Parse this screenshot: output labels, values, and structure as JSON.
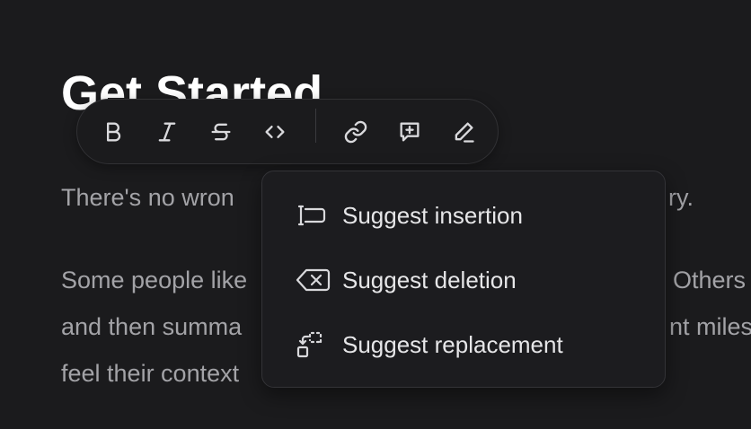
{
  "document": {
    "title": "Get Started",
    "paragraphs": [
      {
        "lines": [
          {
            "before": "There's no wron",
            "after": "ry."
          }
        ]
      },
      {
        "lines": [
          {
            "before": "Some people like",
            "after": "Others"
          },
          {
            "before": "and then summa",
            "after": "nt miles"
          },
          {
            "before": "feel their context",
            "after": ""
          }
        ]
      }
    ]
  },
  "toolbar": {
    "buttons": [
      {
        "name": "bold-button",
        "icon": "bold-icon"
      },
      {
        "name": "italic-button",
        "icon": "italic-icon"
      },
      {
        "name": "strikethrough-button",
        "icon": "strikethrough-icon"
      },
      {
        "name": "code-button",
        "icon": "code-icon"
      },
      {
        "name": "link-button",
        "icon": "link-icon"
      },
      {
        "name": "add-comment-button",
        "icon": "comment-plus-icon"
      },
      {
        "name": "suggest-button",
        "icon": "pencil-icon"
      }
    ]
  },
  "suggest_menu": {
    "items": [
      {
        "label": "Suggest insertion",
        "icon": "text-cursor-insert-icon"
      },
      {
        "label": "Suggest deletion",
        "icon": "backspace-x-icon"
      },
      {
        "label": "Suggest replacement",
        "icon": "replace-icon"
      }
    ]
  },
  "colors": {
    "background": "#1b1b1d",
    "title": "#ffffff",
    "body_text": "#a3a3a7",
    "icon": "#d9d9dc",
    "menu_text": "#e6e6e8",
    "border": "#313134"
  }
}
